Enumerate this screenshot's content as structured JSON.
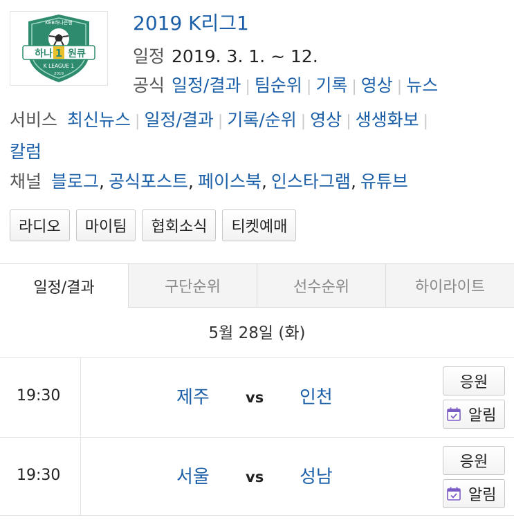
{
  "header": {
    "title": "2019 K리그1",
    "schedule_label": "일정",
    "schedule_value": "2019. 3. 1. ~ 12.",
    "official_label": "공식",
    "official_links": [
      "일정/결과",
      "팀순위",
      "기록",
      "영상",
      "뉴스"
    ]
  },
  "logo": {
    "top_text": "KEB하나은행",
    "main_text": "하나",
    "num": "1",
    "suffix": "원큐",
    "league_text": "K LEAGUE 1",
    "year": "2019"
  },
  "services": {
    "label": "서비스",
    "links": [
      "최신뉴스",
      "일정/결과",
      "기록/순위",
      "영상",
      "생생화보",
      "칼럼"
    ]
  },
  "channels": {
    "label": "채널",
    "links": [
      "블로그",
      "공식포스트",
      "페이스북",
      "인스타그램",
      "유튜브"
    ]
  },
  "buttons": [
    "라디오",
    "마이팀",
    "협회소식",
    "티켓예매"
  ],
  "tabs": [
    "일정/결과",
    "구단순위",
    "선수순위",
    "하이라이트"
  ],
  "date": "5월 28일 (화)",
  "matches": [
    {
      "time": "19:30",
      "home": "제주",
      "vs": "vs",
      "away": "인천",
      "cheer": "응원",
      "alarm": "알림"
    },
    {
      "time": "19:30",
      "home": "서울",
      "vs": "vs",
      "away": "성남",
      "cheer": "응원",
      "alarm": "알림"
    }
  ],
  "colors": {
    "link": "#1a5fa8",
    "logo_green": "#2e8b6e",
    "icon_purple": "#7b5cc4"
  }
}
